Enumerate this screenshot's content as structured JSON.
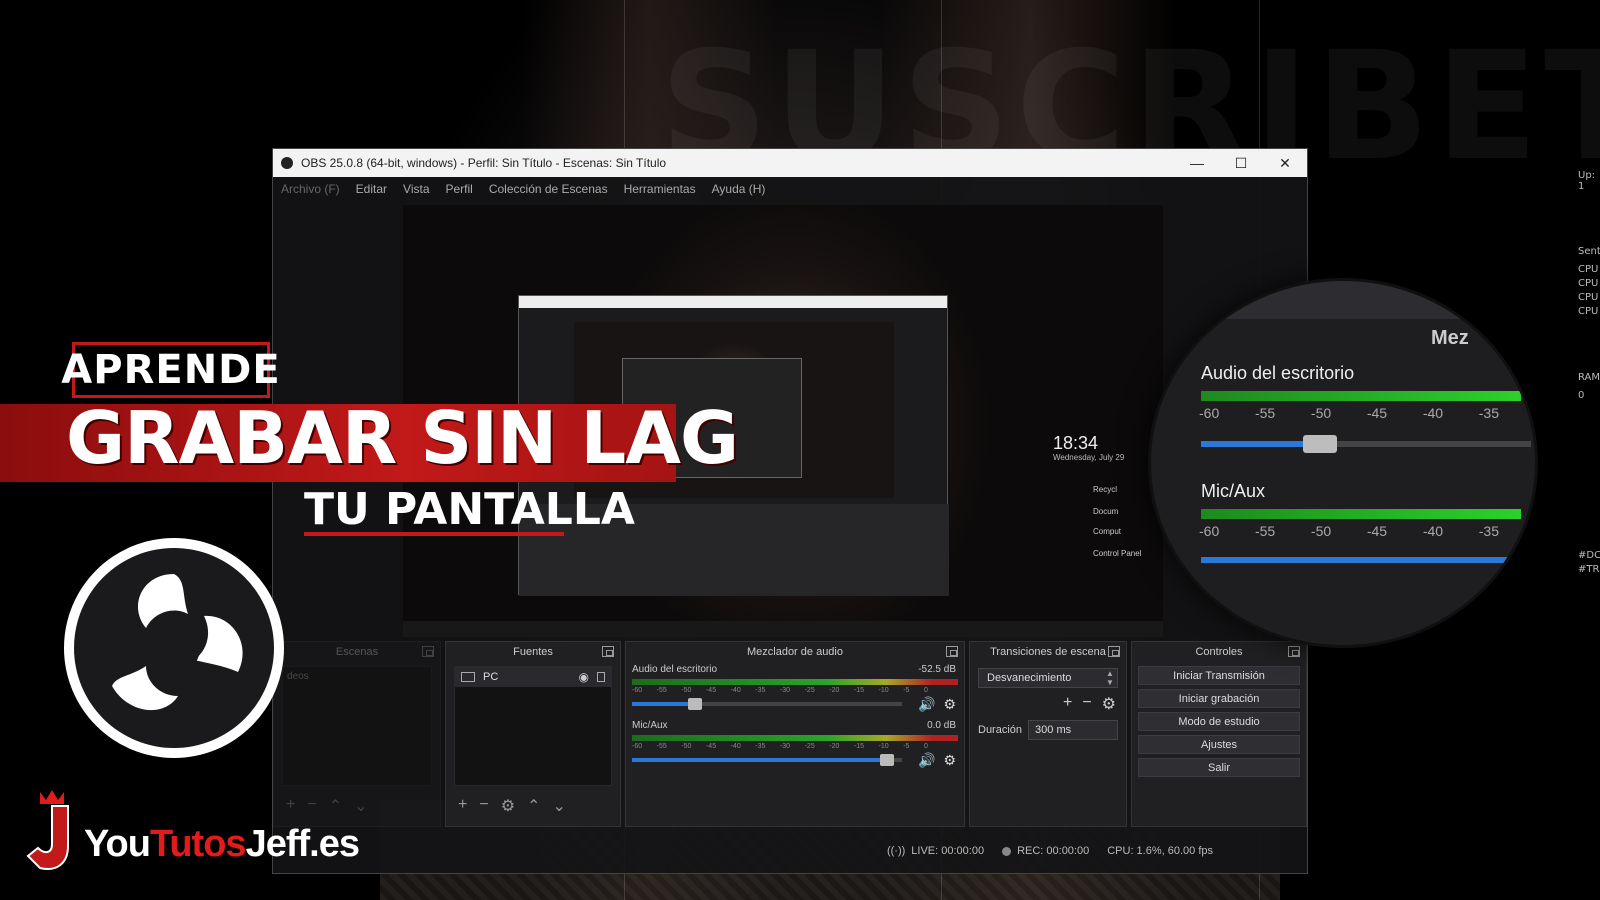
{
  "background": {
    "watermark": "SUSCRIBETE"
  },
  "side_text": [
    "Up: 1",
    "Sent",
    "CPU",
    "CPU",
    "CPU",
    "CPU",
    "RAM",
    "0",
    "#DC",
    "#TR"
  ],
  "obs_window": {
    "title": "OBS 25.0.8 (64-bit, windows) - Perfil: Sin Título - Escenas: Sin Título",
    "window_controls": {
      "minimize": "—",
      "maximize": "☐",
      "close": "✕"
    },
    "menu": [
      "Archivo (F)",
      "Editar",
      "Vista",
      "Perfil",
      "Colección de Escenas",
      "Herramientas",
      "Ayuda (H)"
    ],
    "preview": {
      "clock": "18:34",
      "date": "Wednesday, July 29",
      "desktop_items": [
        "Recycl",
        "Docum",
        "Comput",
        "Control Panel"
      ]
    },
    "docks": {
      "scenes": {
        "title": "Escenas",
        "item": "deos"
      },
      "sources": {
        "title": "Fuentes",
        "items": [
          {
            "name": "PC"
          }
        ]
      },
      "mixer": {
        "title": "Mezclador de audio",
        "channels": [
          {
            "name": "Audio del escritorio",
            "db": "-52.5 dB",
            "volume": 0.22
          },
          {
            "name": "Mic/Aux",
            "db": "0.0 dB",
            "volume": 0.97
          }
        ],
        "ticks": [
          "-60",
          "-55",
          "-50",
          "-45",
          "-40",
          "-35",
          "-30",
          "-25",
          "-20",
          "-15",
          "-10",
          "-5",
          "0"
        ]
      },
      "transitions": {
        "title": "Transiciones de escena",
        "selected": "Desvanecimiento",
        "duration_label": "Duración",
        "duration_value": "300 ms"
      },
      "controls": {
        "title": "Controles",
        "buttons": [
          "Iniciar Transmisión",
          "Iniciar grabación",
          "Modo de estudio",
          "Ajustes",
          "Salir"
        ]
      }
    },
    "status": {
      "live": "LIVE: 00:00:00",
      "rec": "REC: 00:00:00",
      "cpu": "CPU: 1.6%, 60.00 fps"
    }
  },
  "magnifier": {
    "header": "Mez",
    "channel1": "Audio del escritorio",
    "channel2": "Mic/Aux",
    "ticks": [
      "-60",
      "-55",
      "-50",
      "-45",
      "-40",
      "-35"
    ],
    "channel1_volume": 0.36,
    "channel2_volume": 0.95
  },
  "overlay": {
    "line1": "APRENDE",
    "line2": "GRABAR SIN LAG",
    "line3": "TU PANTALLA"
  },
  "brand": {
    "part1": "You",
    "part2": "Tutos",
    "part3": "Jeff.es"
  },
  "colors": {
    "accent_red": "#c21a1a",
    "obs_blue": "#2a78d8",
    "meter_green": "#2aa42a"
  }
}
